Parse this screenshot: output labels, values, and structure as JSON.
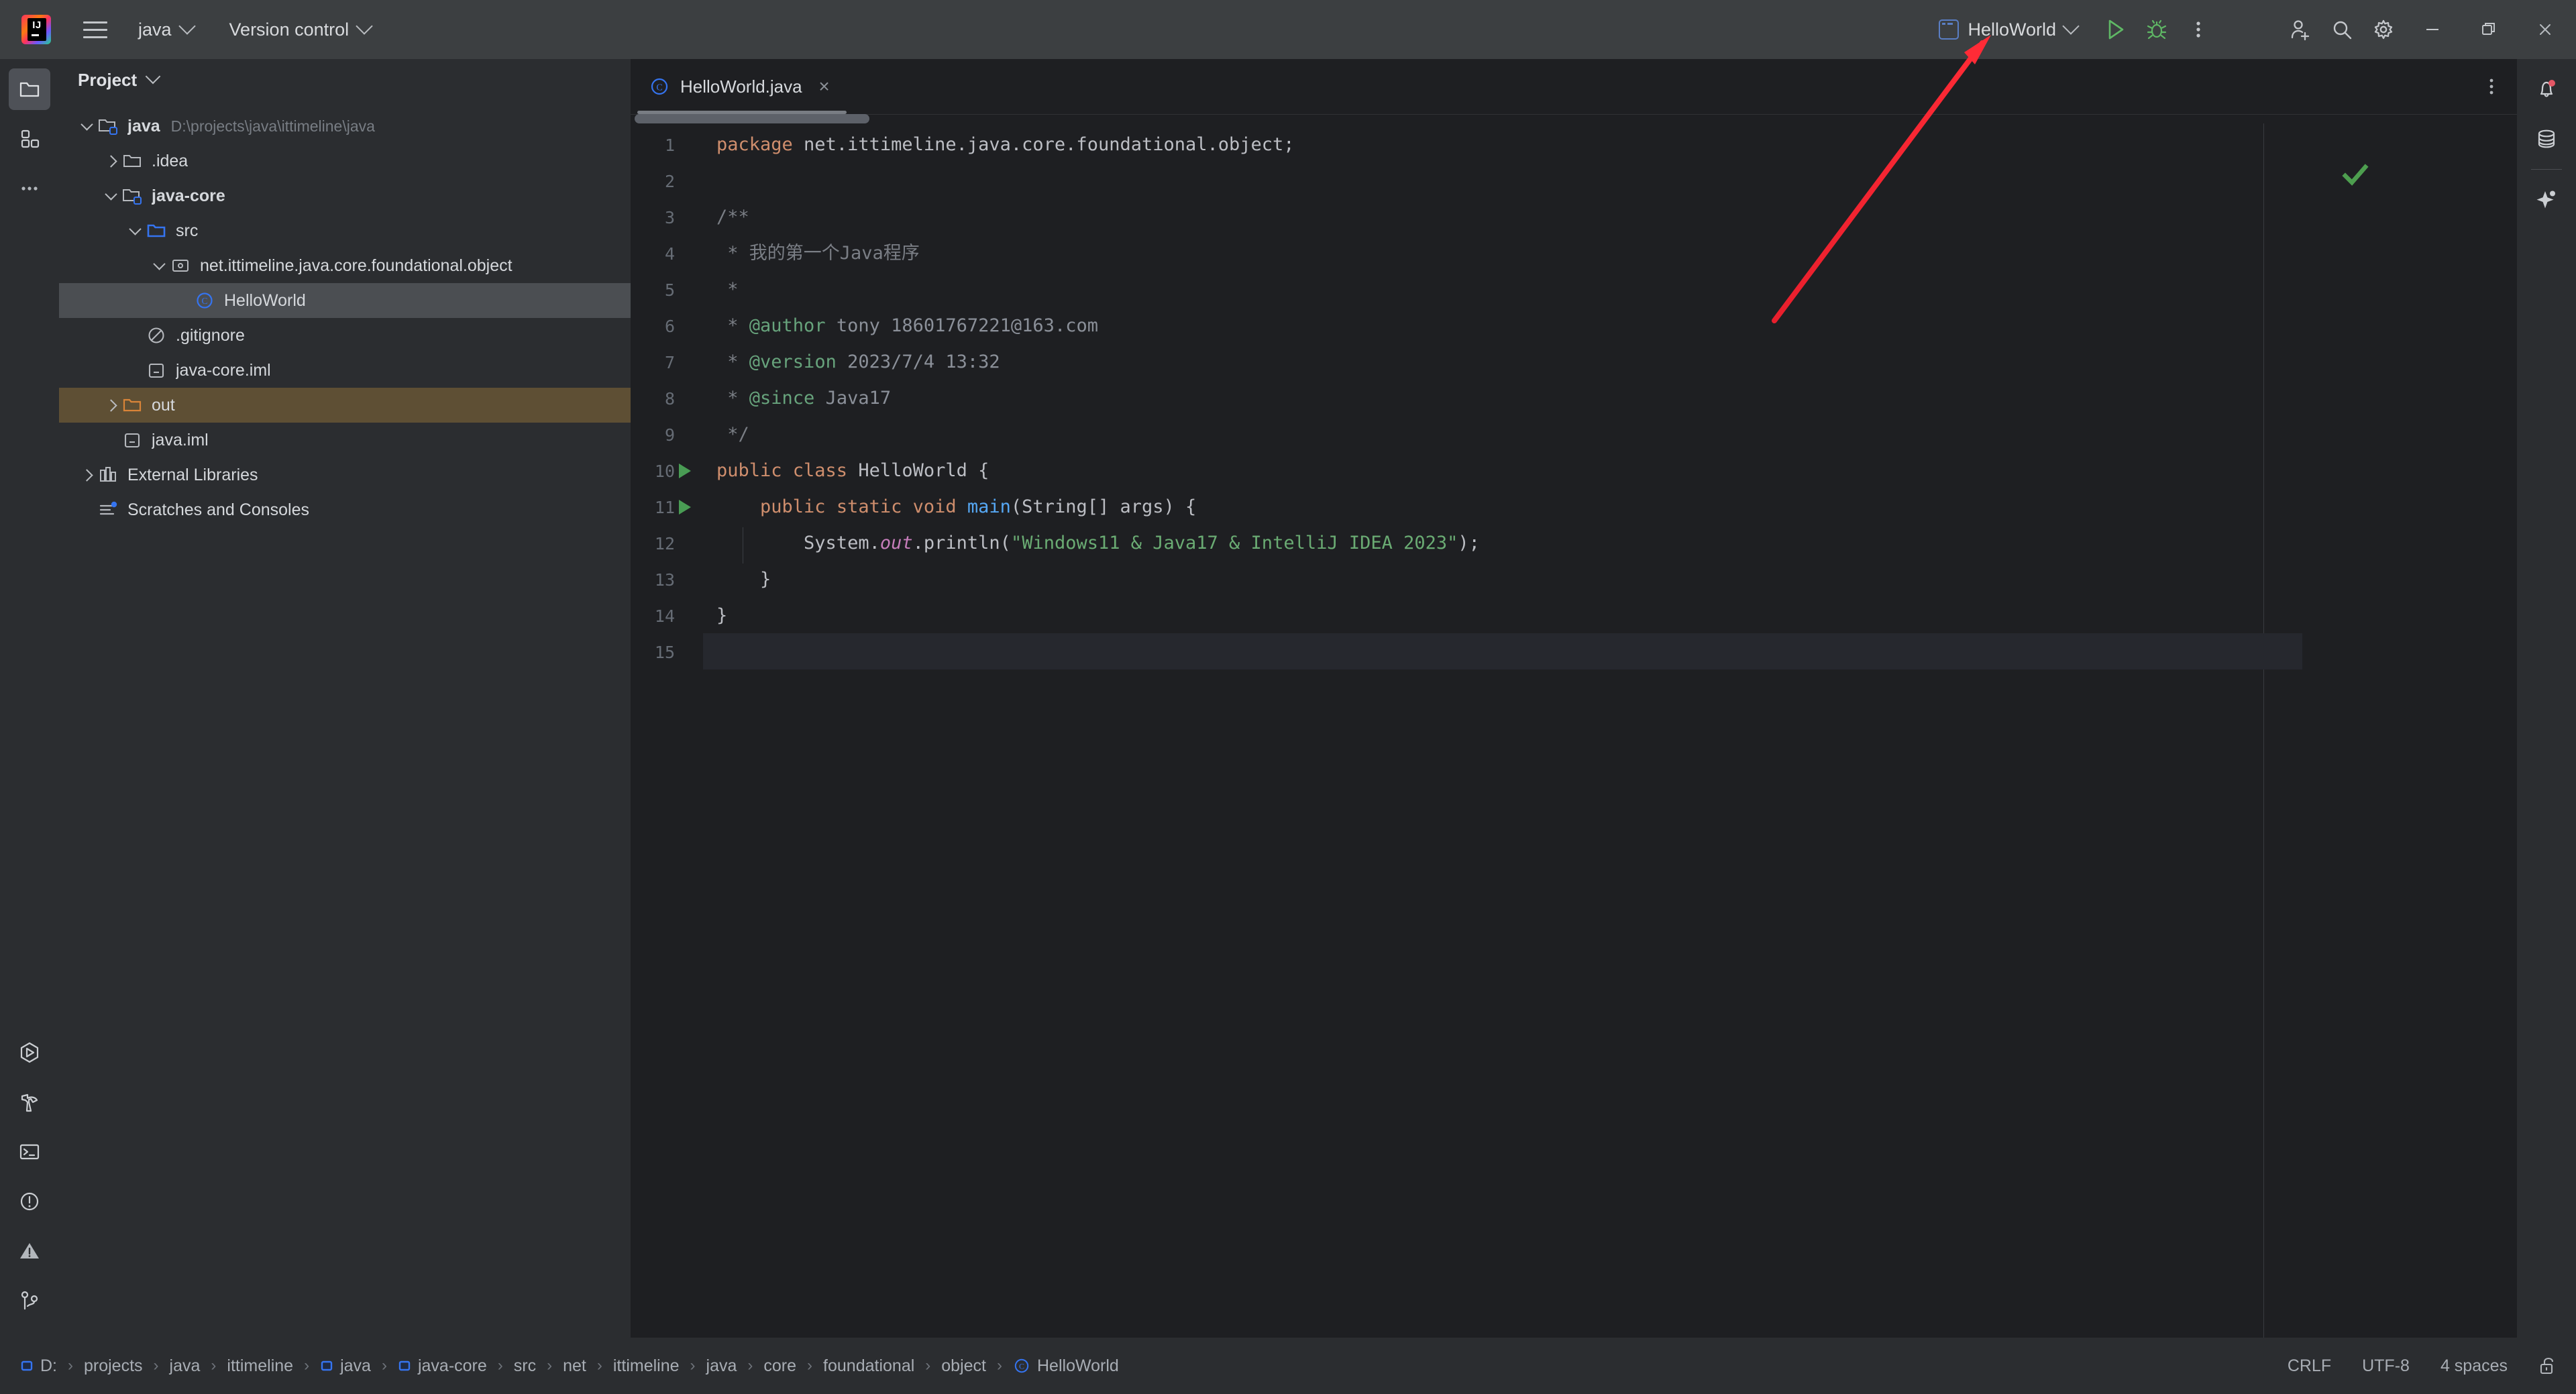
{
  "titlebar": {
    "project_menu": "java",
    "vcs_menu": "Version control",
    "run_config": "HelloWorld",
    "icons": {
      "logo": "intellij-idea-logo",
      "hamburger": "main-menu-icon",
      "run": "run-icon",
      "debug": "debug-icon",
      "more": "more-vertical-icon",
      "account": "add-account-icon",
      "search": "search-icon",
      "settings": "gear-icon",
      "minimize": "minimize-icon",
      "maximize": "maximize-icon",
      "close": "close-icon"
    }
  },
  "left_rail": {
    "top": [
      "project-icon",
      "commit-icon",
      "more-tool-windows-icon"
    ],
    "bottom": [
      "run-tool-icon",
      "build-icon",
      "terminal-icon",
      "problems-icon",
      "services-warning-icon",
      "version-control-icon"
    ]
  },
  "right_rail": {
    "items": [
      "notifications-bell-icon",
      "database-icon",
      "ai-assistant-icon"
    ]
  },
  "project_panel": {
    "title": "Project",
    "tree": [
      {
        "label": "java",
        "suffix": "D:\\projects\\java\\ittimeline\\java",
        "icon": "module-folder-icon",
        "indent": 0,
        "arrow": "down",
        "bold": true,
        "state": "normal"
      },
      {
        "label": ".idea",
        "suffix": "",
        "icon": "folder-icon",
        "indent": 1,
        "arrow": "right",
        "bold": false,
        "state": "normal"
      },
      {
        "label": "java-core",
        "suffix": "",
        "icon": "module-folder-icon",
        "indent": 1,
        "arrow": "down",
        "bold": true,
        "state": "normal"
      },
      {
        "label": "src",
        "suffix": "",
        "icon": "source-folder-icon",
        "indent": 2,
        "arrow": "down",
        "bold": false,
        "state": "normal"
      },
      {
        "label": "net.ittimeline.java.core.foundational.object",
        "suffix": "",
        "icon": "package-icon",
        "indent": 3,
        "arrow": "down",
        "bold": false,
        "state": "normal"
      },
      {
        "label": "HelloWorld",
        "suffix": "",
        "icon": "java-class-icon",
        "indent": 4,
        "arrow": "none",
        "bold": false,
        "state": "selected"
      },
      {
        "label": ".gitignore",
        "suffix": "",
        "icon": "gitignore-icon",
        "indent": 2,
        "arrow": "none",
        "bold": false,
        "state": "normal"
      },
      {
        "label": "java-core.iml",
        "suffix": "",
        "icon": "iml-file-icon",
        "indent": 2,
        "arrow": "none",
        "bold": false,
        "state": "normal"
      },
      {
        "label": "out",
        "suffix": "",
        "icon": "excluded-folder-icon",
        "indent": 1,
        "arrow": "right",
        "bold": false,
        "state": "highlighted"
      },
      {
        "label": "java.iml",
        "suffix": "",
        "icon": "iml-file-icon",
        "indent": 1,
        "arrow": "none",
        "bold": false,
        "state": "normal"
      },
      {
        "label": "External Libraries",
        "suffix": "",
        "icon": "libraries-icon",
        "indent": 0,
        "arrow": "right",
        "bold": false,
        "state": "normal"
      },
      {
        "label": "Scratches and Consoles",
        "suffix": "",
        "icon": "scratches-icon",
        "indent": 0,
        "arrow": "none",
        "bold": false,
        "state": "normal"
      }
    ]
  },
  "editor": {
    "tab": {
      "label": "HelloWorld.java",
      "icon": "java-class-icon",
      "close": "×"
    },
    "inspection_status": "ok-check-icon",
    "caret_line": 15,
    "lines": [
      {
        "n": 1,
        "run": false,
        "tokens": [
          {
            "t": "package",
            "c": "kw"
          },
          {
            "t": " net.ittimeline.java.core.foundational.object;",
            "c": "ident"
          }
        ]
      },
      {
        "n": 2,
        "run": false,
        "tokens": []
      },
      {
        "n": 3,
        "run": false,
        "tokens": [
          {
            "t": "/**",
            "c": "cmt"
          }
        ]
      },
      {
        "n": 4,
        "run": false,
        "tokens": [
          {
            "t": " * 我的第一个Java程序",
            "c": "cmt"
          }
        ]
      },
      {
        "n": 5,
        "run": false,
        "tokens": [
          {
            "t": " *",
            "c": "cmt"
          }
        ]
      },
      {
        "n": 6,
        "run": false,
        "tokens": [
          {
            "t": " * ",
            "c": "cmt"
          },
          {
            "t": "@author",
            "c": "tag"
          },
          {
            "t": " tony 18601767221@163.com",
            "c": "tagtxt"
          }
        ]
      },
      {
        "n": 7,
        "run": false,
        "tokens": [
          {
            "t": " * ",
            "c": "cmt"
          },
          {
            "t": "@version",
            "c": "tag"
          },
          {
            "t": " 2023/7/4 13:32",
            "c": "tagtxt"
          }
        ]
      },
      {
        "n": 8,
        "run": false,
        "tokens": [
          {
            "t": " * ",
            "c": "cmt"
          },
          {
            "t": "@since",
            "c": "tag"
          },
          {
            "t": " Java17",
            "c": "tagtxt"
          }
        ]
      },
      {
        "n": 9,
        "run": false,
        "tokens": [
          {
            "t": " */",
            "c": "cmt"
          }
        ]
      },
      {
        "n": 10,
        "run": true,
        "tokens": [
          {
            "t": "public class ",
            "c": "kw"
          },
          {
            "t": "HelloWorld",
            "c": "cn"
          },
          {
            "t": " {",
            "c": "ident"
          }
        ]
      },
      {
        "n": 11,
        "run": true,
        "tokens": [
          {
            "t": "    ",
            "c": "ident"
          },
          {
            "t": "public static void ",
            "c": "kw"
          },
          {
            "t": "main",
            "c": "fn"
          },
          {
            "t": "(String[] args) {",
            "c": "ident"
          }
        ]
      },
      {
        "n": 12,
        "run": false,
        "tokens": [
          {
            "t": "        System.",
            "c": "ident"
          },
          {
            "t": "out",
            "c": "fld"
          },
          {
            "t": ".println(",
            "c": "ident"
          },
          {
            "t": "\"Windows11 & Java17 & IntelliJ IDEA 2023\"",
            "c": "str"
          },
          {
            "t": ");",
            "c": "ident"
          }
        ]
      },
      {
        "n": 13,
        "run": false,
        "tokens": [
          {
            "t": "    }",
            "c": "ident"
          }
        ]
      },
      {
        "n": 14,
        "run": false,
        "tokens": [
          {
            "t": "}",
            "c": "ident"
          }
        ]
      },
      {
        "n": 15,
        "run": false,
        "tokens": []
      }
    ]
  },
  "status_bar": {
    "breadcrumbs": [
      {
        "label": "D:",
        "icon": "drive-icon"
      },
      {
        "label": "projects",
        "icon": ""
      },
      {
        "label": "java",
        "icon": ""
      },
      {
        "label": "ittimeline",
        "icon": ""
      },
      {
        "label": "java",
        "icon": "module-icon"
      },
      {
        "label": "java-core",
        "icon": "module-icon"
      },
      {
        "label": "src",
        "icon": ""
      },
      {
        "label": "net",
        "icon": ""
      },
      {
        "label": "ittimeline",
        "icon": ""
      },
      {
        "label": "java",
        "icon": ""
      },
      {
        "label": "core",
        "icon": ""
      },
      {
        "label": "foundational",
        "icon": ""
      },
      {
        "label": "object",
        "icon": ""
      },
      {
        "label": "HelloWorld",
        "icon": "java-class-icon"
      }
    ],
    "line_separator": "CRLF",
    "encoding": "UTF-8",
    "indent": "4 spaces",
    "lock": "unlocked-readonly-icon"
  },
  "annotation": {
    "type": "red-arrow",
    "color": "#ff2b36",
    "points_to": "run-button"
  },
  "colors": {
    "titlebar_bg": "#3c3f41",
    "panel_bg": "#2b2d30",
    "editor_bg": "#1e1f22",
    "selection": "#4b4e52",
    "highlight_row": "#5e4f34",
    "run_green": "#499c54",
    "accent_blue": "#3574f0"
  }
}
